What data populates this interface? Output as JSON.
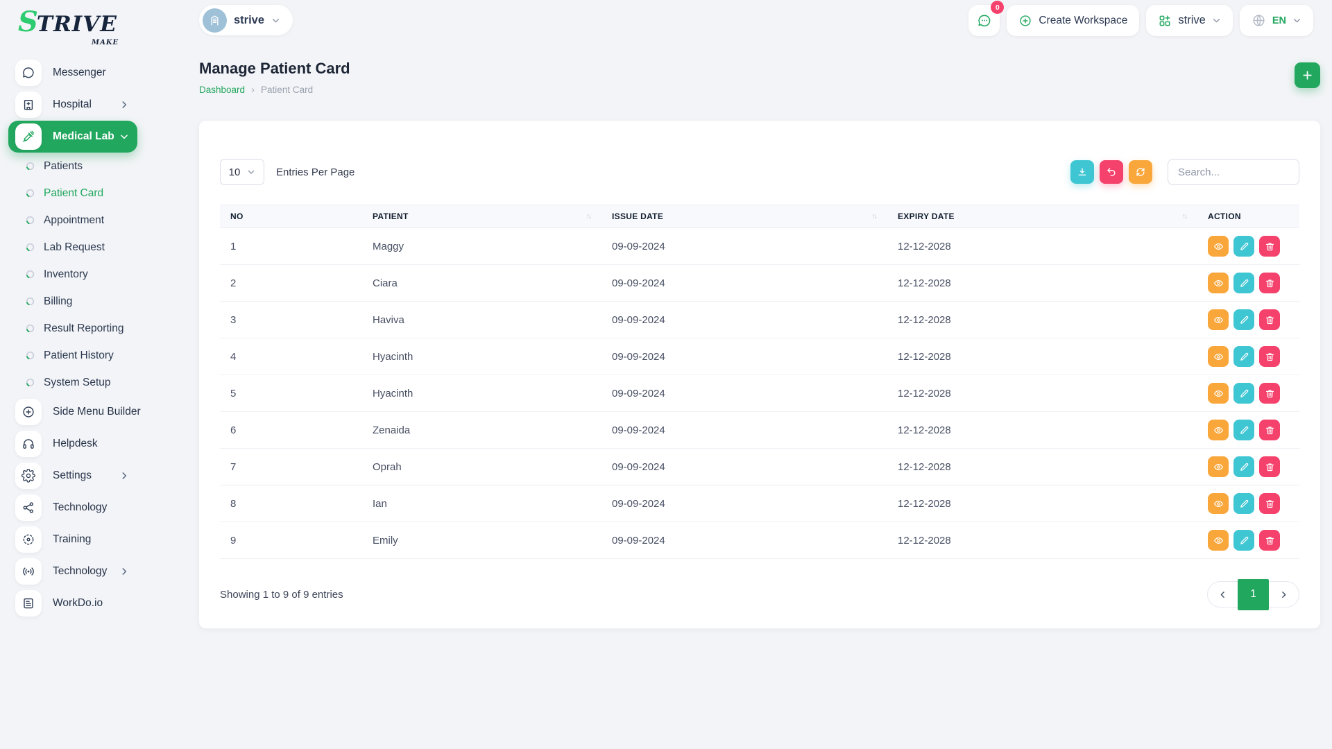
{
  "brand": {
    "name_first": "S",
    "name_rest": "TRIVE",
    "tagline": "MAKE"
  },
  "header": {
    "workspace_pill_label": "strive",
    "messages_badge": "0",
    "create_workspace_label": "Create Workspace",
    "workspace_dropdown_label": "strive",
    "language_label": "EN"
  },
  "sidebar": {
    "items": [
      {
        "label": "Messenger"
      },
      {
        "label": "Hospital"
      },
      {
        "label": "Medical Lab"
      },
      {
        "label": "Patients"
      },
      {
        "label": "Patient Card"
      },
      {
        "label": "Appointment"
      },
      {
        "label": "Lab Request"
      },
      {
        "label": "Inventory"
      },
      {
        "label": "Billing"
      },
      {
        "label": "Result Reporting"
      },
      {
        "label": "Patient History"
      },
      {
        "label": "System Setup"
      },
      {
        "label": "Side Menu Builder"
      },
      {
        "label": "Helpdesk"
      },
      {
        "label": "Settings"
      },
      {
        "label": "Technology"
      },
      {
        "label": "Training"
      },
      {
        "label": "Technology"
      },
      {
        "label": "WorkDo.io"
      }
    ],
    "active_item": "Medical Lab",
    "active_subitem": "Patient Card"
  },
  "page": {
    "title": "Manage Patient Card",
    "breadcrumb_home": "Dashboard",
    "breadcrumb_current": "Patient Card"
  },
  "toolbar": {
    "entries_per_page_value": "10",
    "entries_per_page_label": "Entries Per Page",
    "search_placeholder": "Search..."
  },
  "table": {
    "columns": {
      "no": "NO",
      "patient": "PATIENT",
      "issue": "ISSUE DATE",
      "expiry": "EXPIRY DATE",
      "action": "ACTION"
    },
    "sort_glyph": "↑↓",
    "rows": [
      {
        "no": "1",
        "patient": "Maggy",
        "issue_date": "09-09-2024",
        "expiry_date": "12-12-2028"
      },
      {
        "no": "2",
        "patient": "Ciara",
        "issue_date": "09-09-2024",
        "expiry_date": "12-12-2028"
      },
      {
        "no": "3",
        "patient": "Haviva",
        "issue_date": "09-09-2024",
        "expiry_date": "12-12-2028"
      },
      {
        "no": "4",
        "patient": "Hyacinth",
        "issue_date": "09-09-2024",
        "expiry_date": "12-12-2028"
      },
      {
        "no": "5",
        "patient": "Hyacinth",
        "issue_date": "09-09-2024",
        "expiry_date": "12-12-2028"
      },
      {
        "no": "6",
        "patient": "Zenaida",
        "issue_date": "09-09-2024",
        "expiry_date": "12-12-2028"
      },
      {
        "no": "7",
        "patient": "Oprah",
        "issue_date": "09-09-2024",
        "expiry_date": "12-12-2028"
      },
      {
        "no": "8",
        "patient": "Ian",
        "issue_date": "09-09-2024",
        "expiry_date": "12-12-2028"
      },
      {
        "no": "9",
        "patient": "Emily",
        "issue_date": "09-09-2024",
        "expiry_date": "12-12-2028"
      }
    ]
  },
  "footer": {
    "showing_text": "Showing 1 to 9 of 9 entries",
    "current_page": "1"
  },
  "colors": {
    "accent_green": "#22a75f",
    "logo_green": "#2ecc71",
    "teal": "#3fc6d3",
    "pink": "#f5426c",
    "orange": "#f9a63b",
    "avatar_blue": "#9fc1d8"
  },
  "icons": [
    "chat-icon",
    "hospital-icon",
    "syringe-icon",
    "bullet-ring-icon",
    "plus-circle-icon",
    "headset-icon",
    "gear-icon",
    "hub-icon",
    "target-icon",
    "broadcast-icon",
    "news-icon",
    "building-icon",
    "grid-plus-icon",
    "globe-icon",
    "download-icon",
    "undo-icon",
    "refresh-icon",
    "eye-icon",
    "pencil-icon",
    "trash-icon",
    "chevron-icons",
    "plus-icon",
    "sort-icon"
  ]
}
